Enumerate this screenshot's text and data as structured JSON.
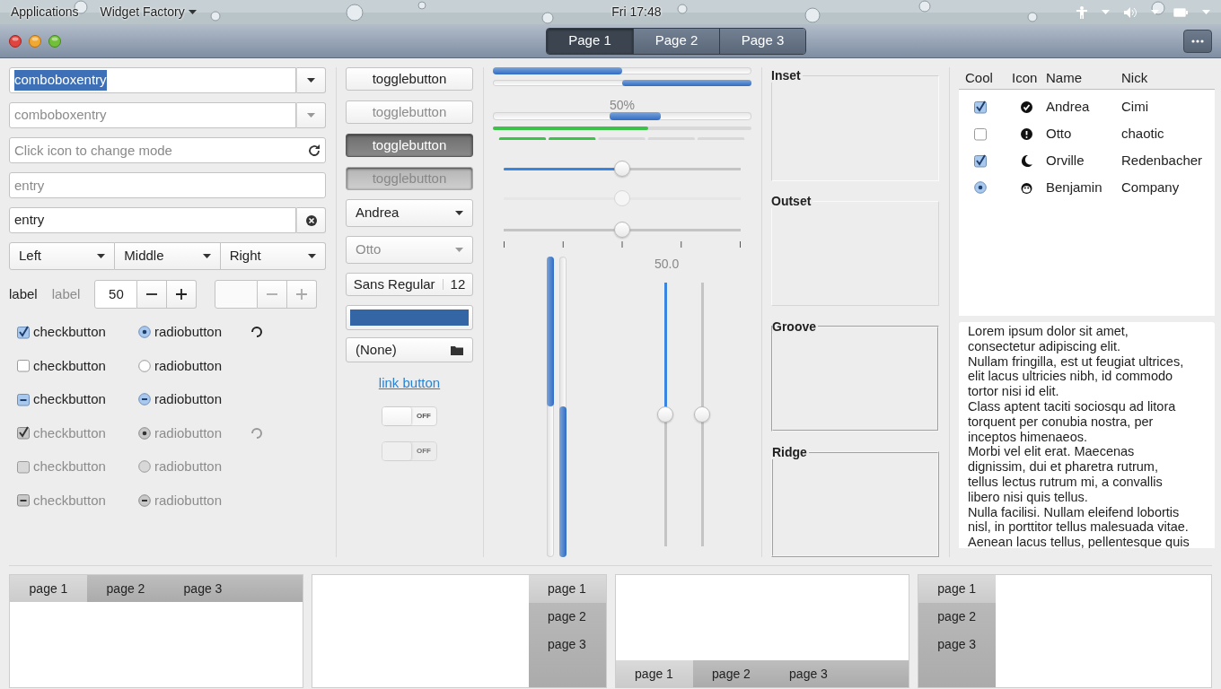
{
  "panel": {
    "menus": [
      {
        "label": "Applications",
        "caret": false
      },
      {
        "label": "Widget Factory",
        "caret": true
      }
    ],
    "clock": "Fri 17:48"
  },
  "stack_switcher": [
    {
      "label": "Page 1",
      "selected": true
    },
    {
      "label": "Page 2",
      "selected": false
    },
    {
      "label": "Page 3",
      "selected": false
    }
  ],
  "entries": [
    {
      "kind": "combo",
      "value": "comboboxentry",
      "text_selected": true,
      "disabled": false
    },
    {
      "kind": "combo",
      "value": "comboboxentry",
      "text_selected": false,
      "disabled": true
    },
    {
      "kind": "icon",
      "placeholder": "Click icon to change mode"
    },
    {
      "kind": "plain",
      "placeholder": "entry"
    },
    {
      "kind": "clear",
      "value": "entry",
      "disabled": false
    }
  ],
  "linked_combos": [
    "Left",
    "Middle",
    "Right"
  ],
  "labels": [
    {
      "text": "label",
      "disabled": false
    },
    {
      "text": "label",
      "disabled": true
    }
  ],
  "spin_buttons": [
    {
      "value": "50",
      "disabled": false
    },
    {
      "disabled": true
    }
  ],
  "check_buttons": [
    {
      "label": "checkbutton",
      "checked": true,
      "inconsistent": false,
      "disabled": false
    },
    {
      "label": "checkbutton",
      "checked": false,
      "inconsistent": false,
      "disabled": false
    },
    {
      "label": "checkbutton",
      "checked": true,
      "inconsistent": true,
      "disabled": false
    },
    {
      "label": "checkbutton",
      "checked": true,
      "inconsistent": false,
      "disabled": true
    },
    {
      "label": "checkbutton",
      "checked": false,
      "inconsistent": false,
      "disabled": true
    },
    {
      "label": "checkbutton",
      "checked": true,
      "inconsistent": true,
      "disabled": true
    }
  ],
  "radio_buttons": [
    {
      "label": "radiobutton",
      "checked": true,
      "inconsistent": false,
      "disabled": false
    },
    {
      "label": "radiobutton",
      "checked": false,
      "inconsistent": false,
      "disabled": false
    },
    {
      "label": "radiobutton",
      "checked": true,
      "inconsistent": true,
      "disabled": false
    },
    {
      "label": "radiobutton",
      "checked": true,
      "inconsistent": false,
      "disabled": true
    },
    {
      "label": "radiobutton",
      "checked": false,
      "inconsistent": false,
      "disabled": true
    },
    {
      "label": "radiobutton",
      "checked": true,
      "inconsistent": true,
      "disabled": true
    }
  ],
  "spinners": [
    {
      "disabled": false
    },
    {
      "disabled": true
    }
  ],
  "toggle_buttons": [
    {
      "label": "togglebutton",
      "active": false,
      "disabled": false
    },
    {
      "label": "togglebutton",
      "active": false,
      "disabled": true
    },
    {
      "label": "togglebutton",
      "active": true,
      "disabled": false
    },
    {
      "label": "togglebutton",
      "active": true,
      "disabled": true
    }
  ],
  "combo_boxes": [
    {
      "value": "Andrea",
      "disabled": false
    },
    {
      "value": "Otto",
      "disabled": true
    }
  ],
  "font_button": {
    "family": "Sans Regular",
    "size": "12"
  },
  "color_button": {
    "color": "#3465a4"
  },
  "file_button": {
    "value": "(None)"
  },
  "link_button": {
    "label": "link button"
  },
  "switches": [
    {
      "label": "OFF",
      "on": false,
      "disabled": false
    },
    {
      "label": "OFF",
      "on": false,
      "disabled": true
    }
  ],
  "progress_bars": [
    {
      "kind": "normal",
      "level": 0.5,
      "inverted": false
    },
    {
      "kind": "normal",
      "level": 0.5,
      "inverted": true
    },
    {
      "kind": "activity",
      "text": "50%",
      "level": 0.55
    }
  ],
  "level_bars": [
    {
      "kind": "continuous",
      "level": 0.6
    },
    {
      "kind": "discrete",
      "level": 0.4
    }
  ],
  "scales": [
    {
      "level": 0.5,
      "fill": true,
      "disabled": false,
      "marks": false
    },
    {
      "level": 0.5,
      "fill": false,
      "disabled": true,
      "marks": false
    },
    {
      "level": 0.5,
      "fill": false,
      "disabled": false,
      "marks": true
    }
  ],
  "vertical_progress": [
    {
      "level": 0.5,
      "inverted": false
    },
    {
      "level": 0.5,
      "inverted": true
    }
  ],
  "vertical_scales": {
    "value": "50.0",
    "sliders": [
      {
        "level": 0.5,
        "fill": true
      },
      {
        "level": 0.5,
        "fill": false
      }
    ]
  },
  "frames": [
    {
      "title": "Inset",
      "kind": "inset"
    },
    {
      "title": "Outset",
      "kind": "outset"
    },
    {
      "title": "Groove",
      "kind": "groove"
    },
    {
      "title": "Ridge",
      "kind": "ridge"
    }
  ],
  "tree": {
    "columns": [
      "Cool",
      "Icon",
      "Name",
      "Nick"
    ],
    "rows": [
      {
        "kind": "check",
        "checked": true,
        "name": "Andrea",
        "nick": "Cimi"
      },
      {
        "kind": "check",
        "checked": false,
        "name": "Otto",
        "nick": "chaotic"
      },
      {
        "kind": "check",
        "checked": true,
        "name": "Orville",
        "nick": "Redenbacher"
      },
      {
        "kind": "radio",
        "checked": true,
        "name": "Benjamin",
        "nick": "Company"
      }
    ]
  },
  "text_view": [
    "Lorem ipsum dolor sit amet, consectetur adipiscing elit.",
    "Nullam fringilla, est ut feugiat ultrices, elit lacus ultricies nibh, id commodo tortor nisi id elit.",
    "Class aptent taciti sociosqu ad litora torquent per conubia nostra, per inceptos himenaeos.",
    "Morbi vel elit erat. Maecenas dignissim, dui et pharetra rutrum, tellus lectus rutrum mi, a convallis libero nisi quis tellus.",
    "Nulla facilisi. Nullam eleifend lobortis nisl, in porttitor tellus malesuada vitae. Aenean lacus tellus, pellentesque quis"
  ],
  "notebooks": [
    {
      "kind": "top",
      "tabs": [
        {
          "label": "page 1",
          "selected": true
        },
        {
          "label": "page 2",
          "selected": false
        },
        {
          "label": "page 3",
          "selected": false
        }
      ]
    },
    {
      "kind": "right",
      "tabs": [
        {
          "label": "page 1",
          "selected": true
        },
        {
          "label": "page 2",
          "selected": false
        },
        {
          "label": "page 3",
          "selected": false
        }
      ]
    },
    {
      "kind": "bottom",
      "tabs": [
        {
          "label": "page 1",
          "selected": true
        },
        {
          "label": "page 2",
          "selected": false
        },
        {
          "label": "page 3",
          "selected": false
        }
      ]
    },
    {
      "kind": "left",
      "tabs": [
        {
          "label": "page 1",
          "selected": true
        },
        {
          "label": "page 2",
          "selected": false
        },
        {
          "label": "page 3",
          "selected": false
        }
      ]
    }
  ]
}
